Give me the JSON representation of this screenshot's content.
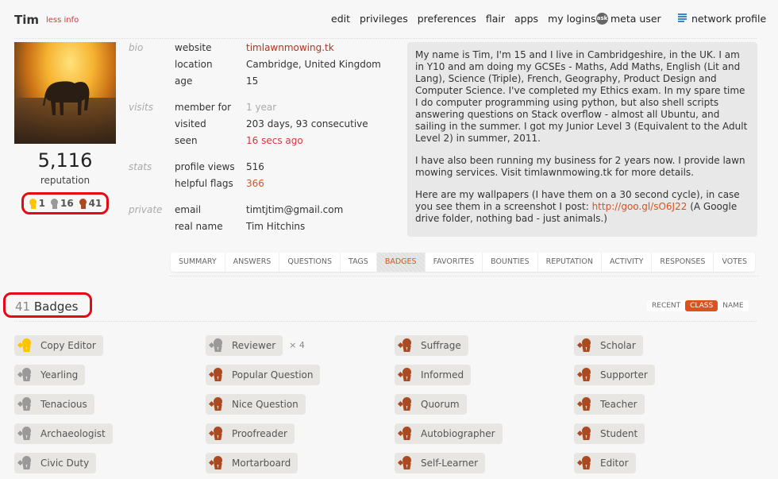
{
  "header": {
    "username": "Tim",
    "less_info": "less info",
    "nav": [
      "edit",
      "privileges",
      "preferences",
      "flair",
      "apps",
      "my logins"
    ],
    "meta_user": "meta user",
    "meta_icon_text": "ask",
    "network_profile": "network profile"
  },
  "profile": {
    "reputation": "5,116",
    "reputation_label": "reputation",
    "badge_counts": {
      "gold": "1",
      "silver": "16",
      "bronze": "41"
    }
  },
  "info": {
    "bio": {
      "category": "bio",
      "rows": [
        {
          "key": "website",
          "value": "timlawnmowing.tk"
        },
        {
          "key": "location",
          "value": "Cambridge, United Kingdom"
        },
        {
          "key": "age",
          "value": "15"
        }
      ]
    },
    "visits": {
      "category": "visits",
      "rows": [
        {
          "key": "member for",
          "value": "1 year"
        },
        {
          "key": "visited",
          "value": "203 days, 93 consecutive"
        },
        {
          "key": "seen",
          "value": "16 secs ago"
        }
      ]
    },
    "stats": {
      "category": "stats",
      "rows": [
        {
          "key": "profile views",
          "value": "516"
        },
        {
          "key": "helpful flags",
          "value": "366"
        }
      ]
    },
    "private": {
      "category": "private",
      "rows": [
        {
          "key": "email",
          "value": "timtjtim@gmail.com"
        },
        {
          "key": "real name",
          "value": "Tim Hitchins"
        }
      ]
    }
  },
  "about": {
    "p1": "My name is Tim, I'm 15 and I live in Cambridgeshire, in the UK. I am in Y10 and am doing my GCSEs - Maths, Add Maths, English (Lit and Lang), Science (Triple), French, Geography, Product Design and Computer Science. I've completed my Ethics exam. In my spare time I do computer programming using python, but also shell scripts answering questions on Stack overflow - almost all Ubuntu, and sailing in the summer. I got my Junior Level 3 (Equivalent to the Adult Level 2) in summer, 2011.",
    "p2": "I have also been running my business for 2 years now. I provide lawn mowing services. Visit timlawnmowing.tk for more details.",
    "p3_before": "Here are my wallpapers (I have them on a 30 second cycle), in case you see them in a screenshot I post: ",
    "p3_link": "http://goo.gl/sO6J22",
    "p3_after": " (A Google drive folder, nothing bad - just animals.)"
  },
  "tabs": [
    {
      "label": "SUMMARY",
      "active": false
    },
    {
      "label": "ANSWERS",
      "active": false
    },
    {
      "label": "QUESTIONS",
      "active": false
    },
    {
      "label": "TAGS",
      "active": false
    },
    {
      "label": "BADGES",
      "active": true
    },
    {
      "label": "FAVORITES",
      "active": false
    },
    {
      "label": "BOUNTIES",
      "active": false
    },
    {
      "label": "REPUTATION",
      "active": false
    },
    {
      "label": "ACTIVITY",
      "active": false
    },
    {
      "label": "RESPONSES",
      "active": false
    },
    {
      "label": "VOTES",
      "active": false
    }
  ],
  "badges_section": {
    "count": "41",
    "title": "Badges",
    "sort_options": [
      {
        "label": "RECENT",
        "active": false
      },
      {
        "label": "CLASS",
        "active": true
      },
      {
        "label": "NAME",
        "active": false
      }
    ]
  },
  "badge_columns": [
    [
      {
        "name": "Copy Editor",
        "class": "gold"
      },
      {
        "name": "Yearling",
        "class": "silver"
      },
      {
        "name": "Tenacious",
        "class": "silver"
      },
      {
        "name": "Archaeologist",
        "class": "silver"
      },
      {
        "name": "Civic Duty",
        "class": "silver"
      }
    ],
    [
      {
        "name": "Reviewer",
        "class": "silver",
        "multiplier": "× 4"
      },
      {
        "name": "Popular Question",
        "class": "bronze"
      },
      {
        "name": "Nice Question",
        "class": "bronze"
      },
      {
        "name": "Proofreader",
        "class": "bronze"
      },
      {
        "name": "Mortarboard",
        "class": "bronze"
      }
    ],
    [
      {
        "name": "Suffrage",
        "class": "bronze"
      },
      {
        "name": "Informed",
        "class": "bronze"
      },
      {
        "name": "Quorum",
        "class": "bronze"
      },
      {
        "name": "Autobiographer",
        "class": "bronze"
      },
      {
        "name": "Self-Learner",
        "class": "bronze"
      }
    ],
    [
      {
        "name": "Scholar",
        "class": "bronze"
      },
      {
        "name": "Supporter",
        "class": "bronze"
      },
      {
        "name": "Teacher",
        "class": "bronze"
      },
      {
        "name": "Student",
        "class": "bronze"
      },
      {
        "name": "Editor",
        "class": "bronze"
      }
    ]
  ],
  "colors": {
    "accent": "#d9531e",
    "gold": "#fec400",
    "silver": "#999999",
    "bronze": "#ab4a21",
    "highlight_outline": "#e50914"
  }
}
